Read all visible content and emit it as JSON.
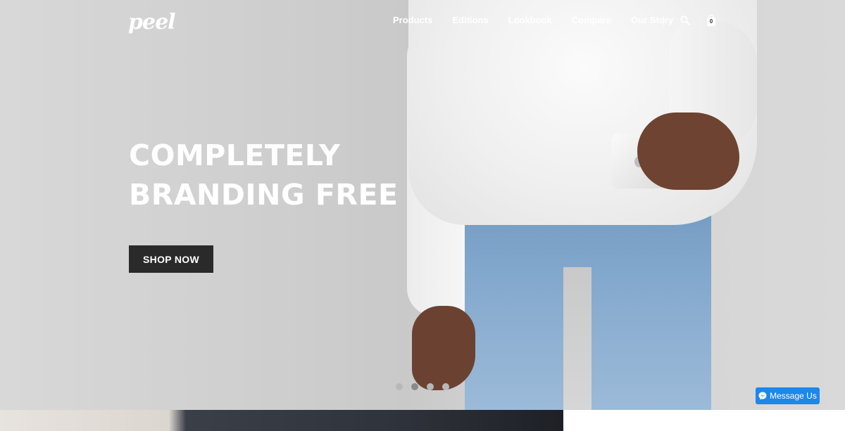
{
  "brand": {
    "logo_text": "peel"
  },
  "nav": {
    "items": [
      {
        "label": "Products"
      },
      {
        "label": "Editions"
      },
      {
        "label": "Lookbook"
      },
      {
        "label": "Compare"
      },
      {
        "label": "Our Story"
      }
    ],
    "cart_count": "0",
    "search_icon": "search-icon",
    "cart_icon": "shopping-bag-icon"
  },
  "hero": {
    "headline_line1": "COMPLETELY",
    "headline_line2": "BRANDING FREE",
    "cta_label": "SHOP NOW",
    "slides_total": 4,
    "active_slide": 2
  },
  "messenger": {
    "label": "Message Us",
    "icon": "messenger-icon",
    "color": "#1d87ea"
  },
  "colors": {
    "cta_bg": "#2a2a2a",
    "hero_text": "#ffffff"
  }
}
